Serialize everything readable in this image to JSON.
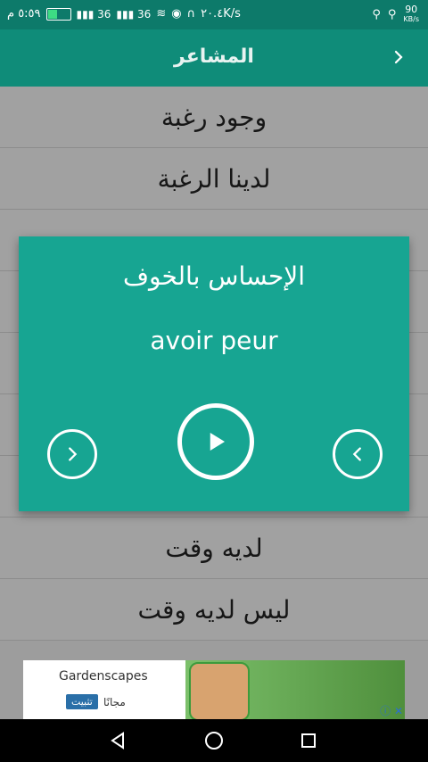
{
  "status": {
    "time": "٥:٥٩ م",
    "speed": "٢٠.٤K/s",
    "net_rate": "90",
    "net_unit": "KB/s",
    "signal_a": "36",
    "signal_b": "36"
  },
  "appbar": {
    "title": "المشاعر"
  },
  "list": [
    {
      "label": "وجود رغبة"
    },
    {
      "label": "لدينا الرغبة"
    },
    {
      "label": ""
    },
    {
      "label": ""
    },
    {
      "label": ""
    },
    {
      "label": ""
    },
    {
      "label": ""
    },
    {
      "label": "لديه وقت"
    },
    {
      "label": "ليس لديه وقت"
    }
  ],
  "dialog": {
    "arabic": "الإحساس بالخوف",
    "french": "avoir peur"
  },
  "ad": {
    "name": "Gardenscapes",
    "price": "مجانًا",
    "install": "تثبيت"
  },
  "colors": {
    "appbar": "#0f8c79",
    "statusbar": "#0d7a6a",
    "dialog": "#17a592"
  }
}
